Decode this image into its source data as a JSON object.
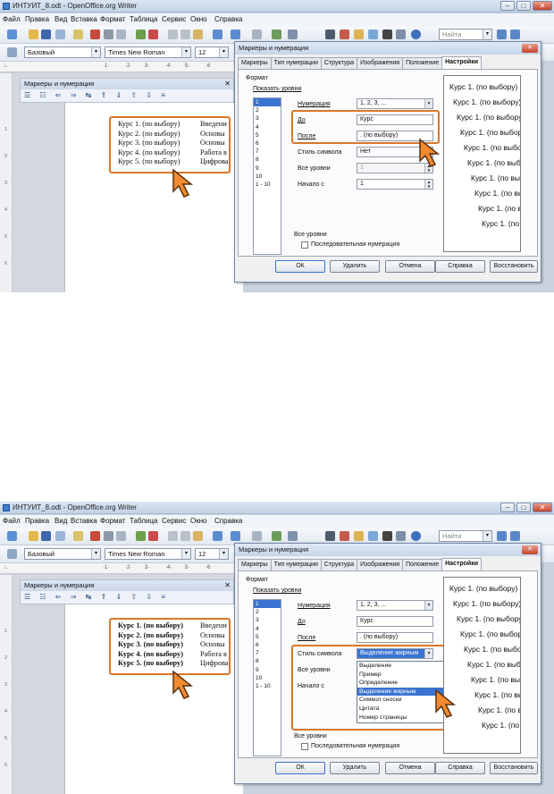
{
  "app": {
    "title": "ИНТУИТ_8.odt - OpenOffice.org Writer",
    "menu": [
      "Файл",
      "Правка",
      "Вид",
      "Вставка",
      "Формат",
      "Таблица",
      "Сервис",
      "Окно",
      "Справка"
    ]
  },
  "toolbar": {
    "style_value": "Базовый",
    "font_value": "Times New Roman",
    "size_value": "12",
    "find_placeholder": "Найти"
  },
  "panel": {
    "title": "Маркеры и нумерация"
  },
  "document": {
    "lines": [
      {
        "num": "Курс 1. (по выбору)",
        "text": "Введени"
      },
      {
        "num": "Курс 2. (по выбору)",
        "text": "Основы"
      },
      {
        "num": "Курс 3. (по выбору)",
        "text": "Основы"
      },
      {
        "num": "Курс 4. (по выбору)",
        "text": "Работа в"
      },
      {
        "num": "Курс 5. (по выбору)",
        "text": "Цифрова"
      }
    ]
  },
  "dialog": {
    "title": "Маркеры и нумерация",
    "tabs": [
      "Маркеры",
      "Тип нумерации",
      "Структура",
      "Изображения",
      "Положение",
      "Настройки"
    ],
    "active_tab": "Настройки",
    "format_label": "Формат",
    "show_levels_label": "Показать уровни",
    "levels": [
      "1",
      "2",
      "3",
      "4",
      "5",
      "6",
      "7",
      "8",
      "9",
      "10",
      "1 - 10"
    ],
    "numbering_label": "Нумерация",
    "numbering_value": "1, 2, 3, ...",
    "before_label": "До",
    "before_value": "Курс",
    "after_label": "После",
    "after_value": ". (по выбору)",
    "char_style_label": "Стиль символа",
    "char_style_value_1": "Нет",
    "char_style_value_2": "Выделение жирным",
    "all_levels_label": "Все уровни",
    "all_levels_value": "1",
    "start_label": "Начало с",
    "start_value": "1",
    "all_levels_group": "Все уровни",
    "consecutive_label": "Последовательная нумерация",
    "preview_item": "Курс 1. (по выбору)",
    "buttons": {
      "ok": "ОК",
      "delete": "Удалить",
      "cancel": "Отмена",
      "help": "Справка",
      "reset": "Восстановить"
    },
    "style_options": [
      "Выделение",
      "Пример",
      "Определение",
      "Выделение жирным",
      "Символ сноски",
      "Цитата",
      "Номер страницы"
    ]
  },
  "colors": {
    "highlight_orange": "#d9782b",
    "selection_blue": "#3a73d1"
  }
}
